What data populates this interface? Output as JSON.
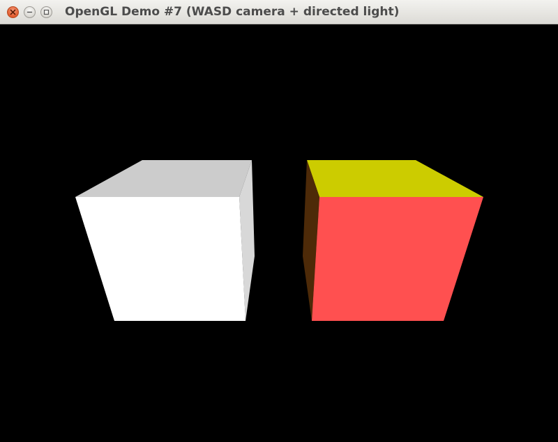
{
  "window": {
    "title": "OpenGL Demo #7 (WASD camera + directed light)"
  },
  "controls": {
    "close_icon": "close-icon",
    "minimize_icon": "minimize-icon",
    "maximize_icon": "maximize-icon"
  },
  "scene": {
    "background": "#000000",
    "cubes": [
      {
        "name": "white-cube",
        "colors": {
          "front": "#ffffff",
          "top": "#cccccc",
          "side": "#d8d8d8"
        }
      },
      {
        "name": "red-cube",
        "colors": {
          "front": "#ff5050",
          "top": "#cccc00",
          "side": "#4d2a08"
        }
      }
    ]
  }
}
